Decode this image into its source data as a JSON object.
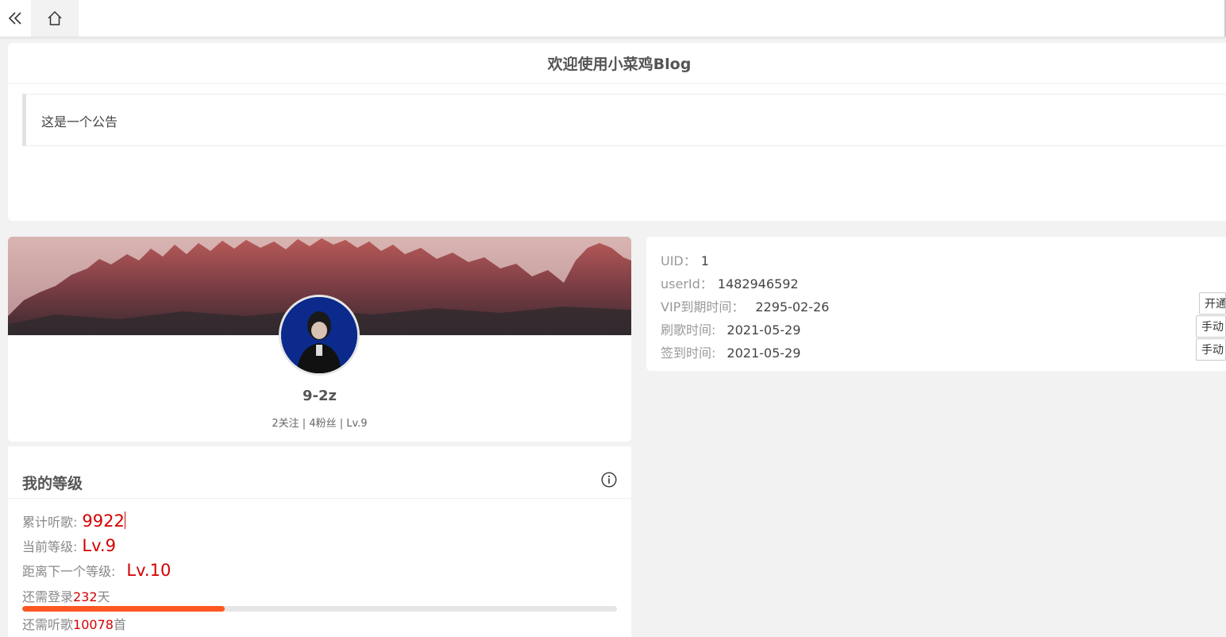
{
  "header": {
    "collapse_icon": "double-chevron-left-icon",
    "home_icon": "home-icon"
  },
  "notice": {
    "title": "欢迎使用小菜鸡Blog",
    "content": "这是一个公告"
  },
  "profile": {
    "nickname": "9-2z",
    "stats": "2关注 | 4粉丝 | Lv.9"
  },
  "account": {
    "uid_label": "UID：",
    "uid_value": "1",
    "userid_label": "userId：",
    "userid_value": "1482946592",
    "vip_label": "VIP到期时间：",
    "vip_value": "2295-02-26",
    "vip_button": "开通",
    "brush_label": "刷歌时间:",
    "brush_value": "2021-05-29",
    "brush_button": "手动",
    "sign_label": "签到时间:",
    "sign_value": "2021-05-29",
    "sign_button": "手动"
  },
  "level": {
    "title": "我的等级",
    "info_icon": "info-icon",
    "total_label": "累计听歌:",
    "total_value": "9922",
    "current_label": "当前等级:",
    "current_value": "Lv.9",
    "next_label": "距离下一个等级:",
    "next_value": "Lv.10",
    "login_prefix": "还需登录",
    "login_days": "232",
    "login_suffix": "天",
    "login_progress_percent": 34,
    "songs_prefix": "还需听歌",
    "songs_count": "10078",
    "songs_suffix": "首"
  },
  "colors": {
    "accent_red": "#d40000",
    "progress_orange": "#ff5722"
  }
}
